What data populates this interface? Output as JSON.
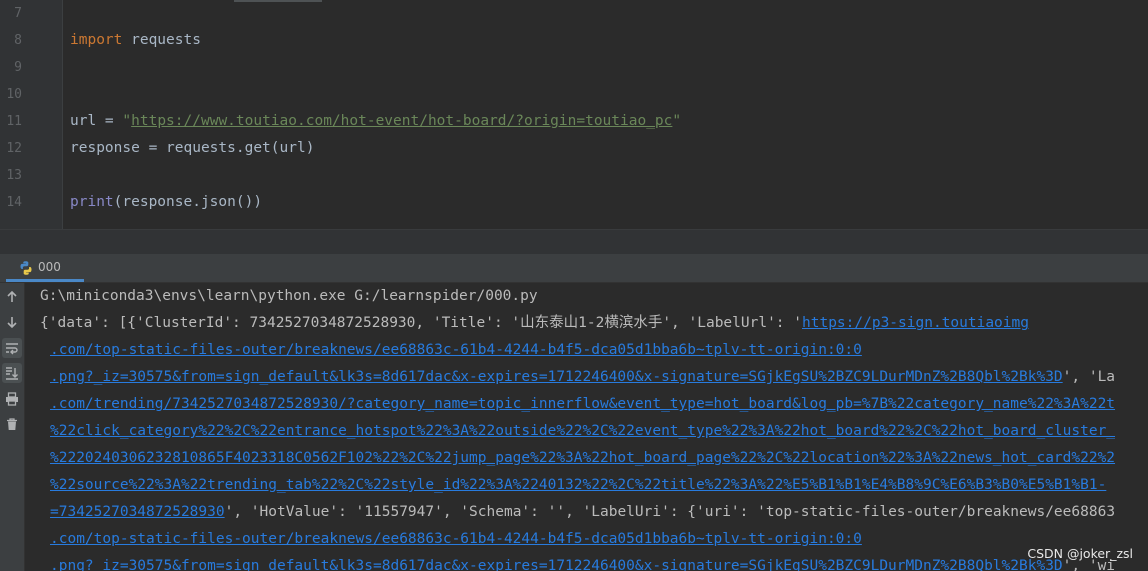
{
  "editor": {
    "lines": [
      {
        "num": "7"
      },
      {
        "num": "8",
        "kw": "import",
        "rest": " requests"
      },
      {
        "num": "9"
      },
      {
        "num": "10"
      },
      {
        "num": "11",
        "var": "url",
        "op": " = ",
        "q1": "\"",
        "url": "https://www.toutiao.com/hot-event/hot-board/?origin=toutiao_pc",
        "q2": "\""
      },
      {
        "num": "12",
        "text": "response = requests.get(url)"
      },
      {
        "num": "13"
      },
      {
        "num": "14",
        "builtin": "print",
        "rest": "(response.json())"
      }
    ]
  },
  "run": {
    "tab_label": "000",
    "icon": "python-icon",
    "toolbar": [
      "arrow-up-icon",
      "arrow-down-icon",
      "soft-wrap-icon",
      "scroll-to-end-icon",
      "print-icon",
      "trash-icon"
    ]
  },
  "console": {
    "cmd": "G:\\miniconda3\\envs\\learn\\python.exe G:/learnspider/000.py",
    "l2_text": "{'data': [{'ClusterId': 7342527034872528930, 'Title': '山东泰山1-2横滨水手', 'LabelUrl': '",
    "l2_link": "https://p3-sign.toutiaoimg",
    "l3_link": ".com/top-static-files-outer/breaknews/ee68863c-61b4-4244-b4f5-dca05d1bba6b~tplv-tt-origin:0:0",
    "l4_link": ".png?_iz=30575&from=sign_default&lk3s=8d617dac&x-expires=1712246400&x-signature=SGjkEgSU%2BZC9LDurMDnZ%2B8Qbl%2Bk%3D",
    "l4_text": "', 'La",
    "l5_link": ".com/trending/7342527034872528930/?category_name=topic_innerflow&event_type=hot_board&log_pb=%7B%22category_name%22%3A%22t",
    "l6_link": "%22click_category%22%2C%22entrance_hotspot%22%3A%22outside%22%2C%22event_type%22%3A%22hot_board%22%2C%22hot_board_cluster_",
    "l7_link": "%2220240306232810865F4023318C0562F102%22%2C%22jump_page%22%3A%22hot_board_page%22%2C%22location%22%3A%22news_hot_card%22%2",
    "l8_link": "%22source%22%3A%22trending_tab%22%2C%22style_id%22%3A%2240132%22%2C%22title%22%3A%22%E5%B1%B1%E4%B8%9C%E6%B3%B0%E5%B1%B1-",
    "l9_link": "=7342527034872528930",
    "l9_text": "', 'HotValue': '11557947', 'Schema': '', 'LabelUri': {'uri': 'top-static-files-outer/breaknews/ee68863",
    "l10_link": ".com/top-static-files-outer/breaknews/ee68863c-61b4-4244-b4f5-dca05d1bba6b~tplv-tt-origin:0:0",
    "l11_link": ".png?_iz=30575&from=sign_default&lk3s=8d617dac&x-expires=1712246400&x-signature=SGjkEgSU%2BZC9LDurMDnZ%2B8Qbl%2Bk%3D",
    "l11_text": "', 'wi"
  },
  "watermark": "CSDN @joker_zsl"
}
